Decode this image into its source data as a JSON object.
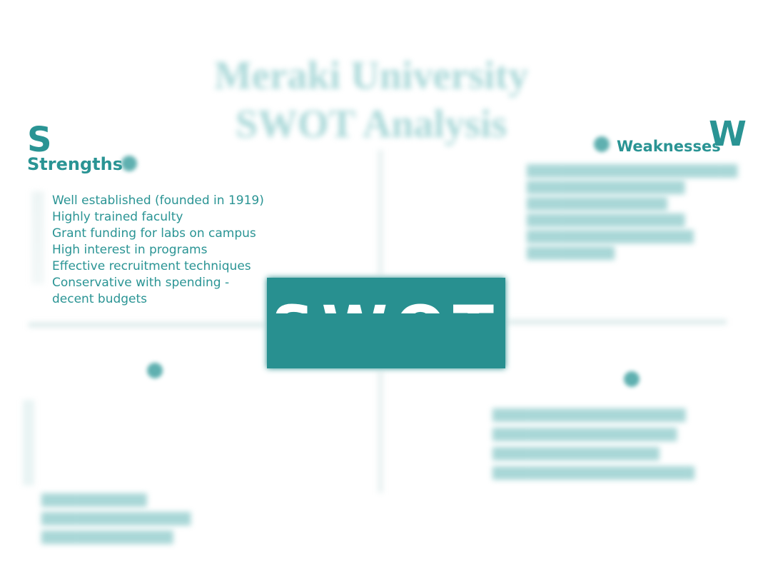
{
  "document": {
    "title_line1": "Meraki University",
    "title_line2": "SWOT Analysis",
    "center_label": "SWOT",
    "accent_color": "#2a9494"
  },
  "strengths": {
    "letter": "S",
    "heading": "Strengths",
    "items": [
      "Well established (founded in 1919)",
      "Highly trained faculty",
      "Grant funding for labs on campus",
      "High interest in programs",
      "Effective recruitment techniques",
      "Conservative with spending - decent budgets"
    ]
  },
  "weaknesses": {
    "letter": "W",
    "heading": "Weaknesses",
    "items": [
      "████████████████████████",
      "██████████████████",
      "████████████████",
      "██████████████████",
      "███████████████████",
      "██████████"
    ]
  },
  "opportunities": {
    "items": [
      "████████████",
      "█████████████████",
      "███████████████"
    ]
  },
  "threats": {
    "items": [
      "██████████████████████",
      "█████████████████████",
      "███████████████████",
      "███████████████████████"
    ]
  }
}
